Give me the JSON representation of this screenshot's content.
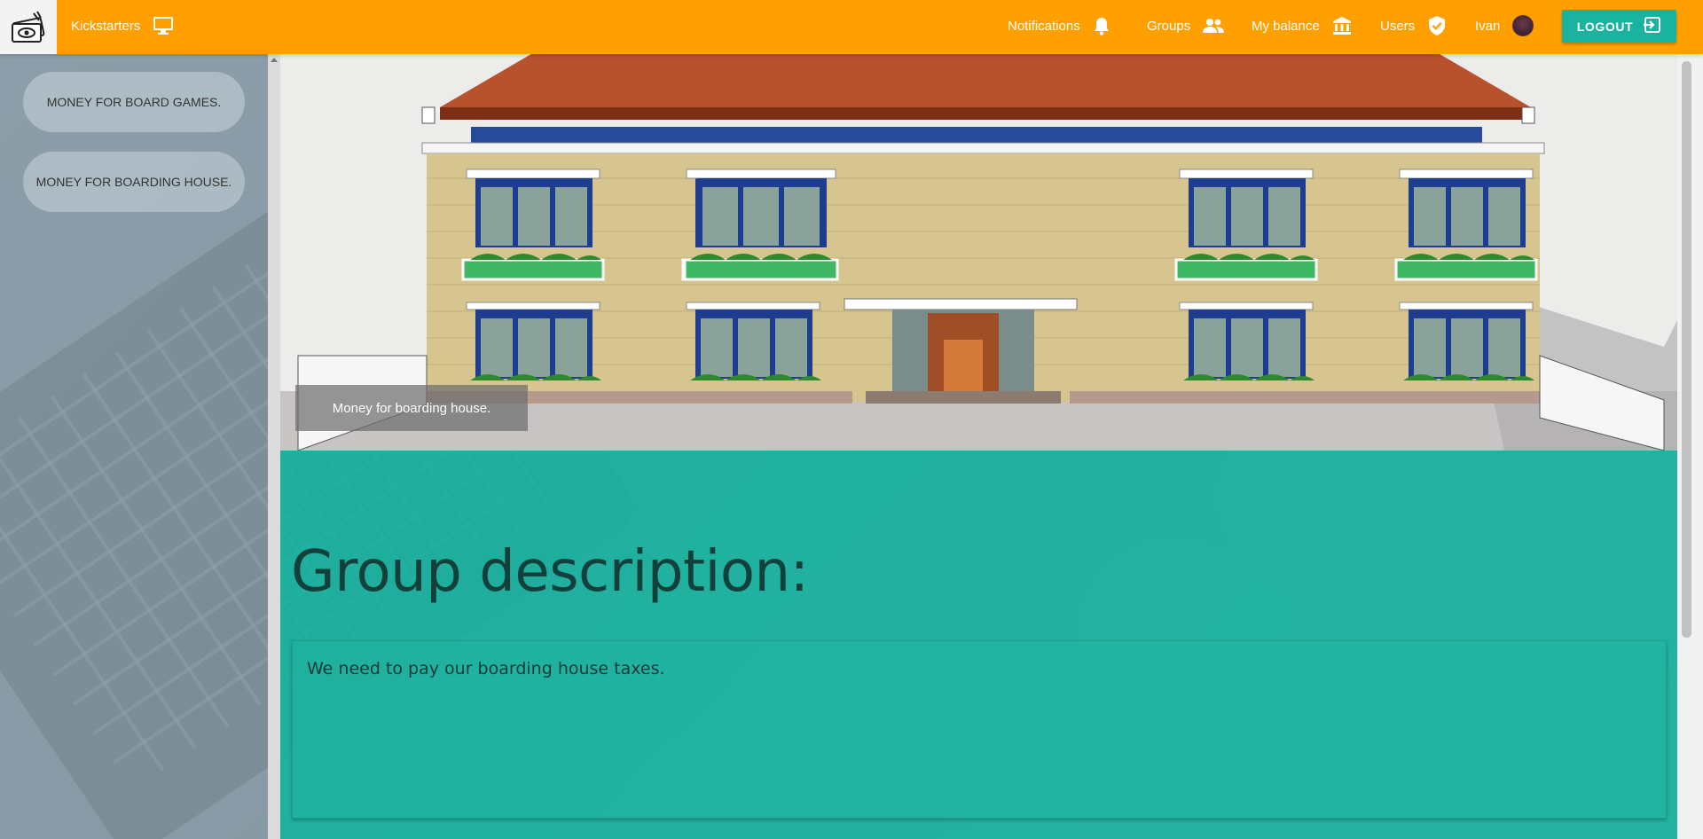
{
  "topbar": {
    "app_label": "Kickstarters",
    "nav": [
      {
        "label": "Notifications",
        "icon": "bell-icon"
      },
      {
        "label": "Groups",
        "icon": "people-icon"
      },
      {
        "label": "My balance",
        "icon": "bank-icon"
      },
      {
        "label": "Users",
        "icon": "verified-shield-icon"
      }
    ],
    "user_name": "Ivan",
    "logout_label": "LOGOUT",
    "accent_color": "#ffa000",
    "button_color": "#1ab39f"
  },
  "sidebar": {
    "items": [
      {
        "label": "Money for board games."
      },
      {
        "label": "Money for boarding house."
      }
    ]
  },
  "main": {
    "image_caption": "Money for boarding house.",
    "section_title": "Group description:",
    "description": "We need to pay our boarding house taxes.",
    "panel_color": "#1ab39f"
  }
}
